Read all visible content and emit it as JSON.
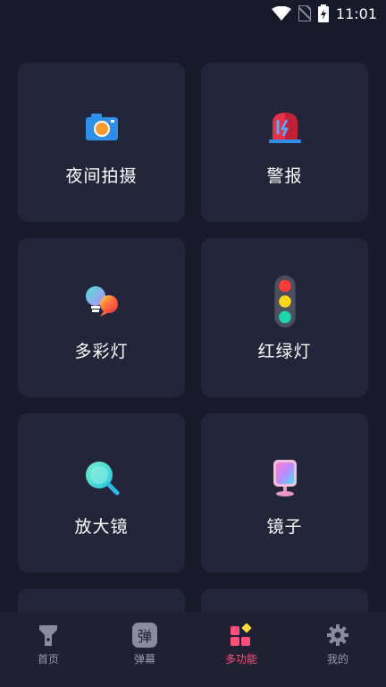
{
  "status_bar": {
    "time": "11:01",
    "icons": [
      "wifi-icon",
      "no-sim-icon",
      "battery-charging-icon"
    ]
  },
  "features": [
    {
      "label": "夜间拍摄",
      "icon": "camera-icon"
    },
    {
      "label": "警报",
      "icon": "siren-icon"
    },
    {
      "label": "多彩灯",
      "icon": "colorful-bulb-icon"
    },
    {
      "label": "红绿灯",
      "icon": "traffic-light-icon"
    },
    {
      "label": "放大镜",
      "icon": "magnifier-icon"
    },
    {
      "label": "镜子",
      "icon": "mirror-icon"
    }
  ],
  "bottom_nav": {
    "items": [
      {
        "label": "首页",
        "icon": "flashlight-icon",
        "active": false
      },
      {
        "label": "弹幕",
        "icon": "danmaku-icon",
        "active": false,
        "icon_text": "弹"
      },
      {
        "label": "多功能",
        "icon": "multi-function-icon",
        "active": true
      },
      {
        "label": "我的",
        "icon": "settings-gear-icon",
        "active": false
      }
    ]
  },
  "colors": {
    "background": "#181a2b",
    "card": "#23263a",
    "nav_background": "#1f2133",
    "nav_active": "#ff4f7a",
    "nav_inactive": "#9a9cab"
  }
}
